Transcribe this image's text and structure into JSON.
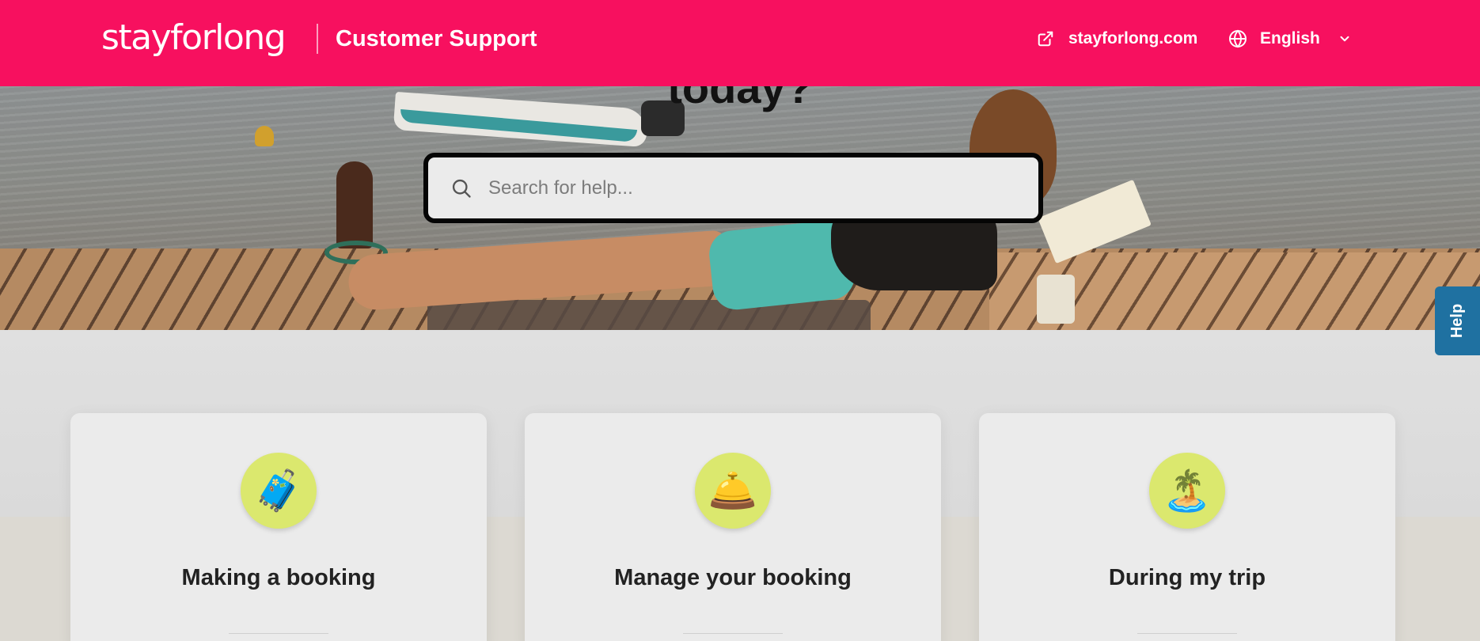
{
  "header": {
    "logo_text": "stayforlong",
    "title": "Customer Support",
    "external_link_label": "stayforlong.com",
    "language_label": "English",
    "background_color": "#f7105f",
    "icons": {
      "external_link": "external-link-icon",
      "language": "globe-icon",
      "dropdown": "chevron-down-icon"
    }
  },
  "hero": {
    "title": "today?",
    "search": {
      "placeholder": "Search for help...",
      "value": "",
      "icon": "search-icon"
    }
  },
  "help_tab": {
    "label": "Help",
    "color": "#1f71a1"
  },
  "categories": [
    {
      "title": "Making a booking",
      "icon": "suitcase-icon",
      "icon_glyph": "🧳"
    },
    {
      "title": "Manage your booking",
      "icon": "bell-icon",
      "icon_glyph": "🛎️"
    },
    {
      "title": "During my trip",
      "icon": "palm-island-icon",
      "icon_glyph": "🏝️"
    }
  ]
}
